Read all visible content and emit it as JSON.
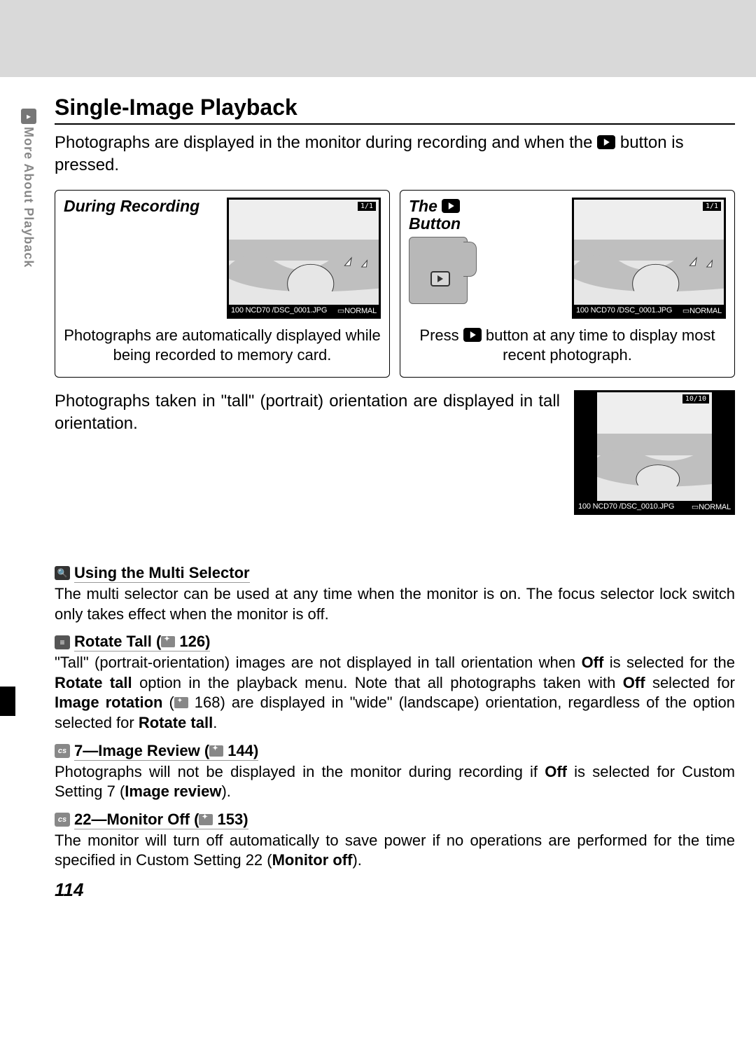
{
  "sidebar": {
    "label": "More About Playback"
  },
  "heading": "Single-Image Playback",
  "intro_a": "Photographs are displayed in the monitor during recording and when the ",
  "intro_b": " button is pressed.",
  "card1": {
    "label": "During Recording",
    "counter": "1/1",
    "file": "100  NCD70  /DSC_0001.JPG",
    "quality": "NORMAL",
    "text": "Photographs are automatically displayed while being recorded to memory card."
  },
  "card2": {
    "label_a": "The ",
    "label_b": " Button",
    "counter": "1/1",
    "file": "100  NCD70  /DSC_0001.JPG",
    "quality": "NORMAL",
    "text_a": "Press ",
    "text_b": " button at any time to display most recent photograph."
  },
  "portrait": {
    "text": "Photographs taken in \"tall\" (portrait) orientation are displayed in tall orientation.",
    "counter": "10/10",
    "file": "100 NCD70 /DSC_0010.JPG",
    "quality": "NORMAL"
  },
  "notes": {
    "n1": {
      "title": "Using the Multi Selector",
      "body": "The multi selector can be used at any time when the monitor is on.  The focus selector lock switch only takes effect when the monitor is off."
    },
    "n2": {
      "title_a": "Rotate Tall (",
      "title_page": " 126)",
      "body": "\"Tall\" (portrait-orientation) images are not displayed in tall orientation when Off is selected for the Rotate tall option in the playback menu.  Note that all photographs taken with Off selected for Image rotation ( 168) are displayed in \"wide\" (landscape) orientation, regardless of the option selected for Rotate tall."
    },
    "n3": {
      "title_a": "7—Image Review (",
      "title_page": " 144)",
      "body": "Photographs will not be displayed in the monitor during recording if Off is selected for Custom Setting 7 (Image review)."
    },
    "n4": {
      "title_a": "22—Monitor Off (",
      "title_page": " 153)",
      "body": "The monitor will turn off automatically to save power if no operations are performed for the time specified in Custom Setting 22 (Monitor off)."
    }
  },
  "pagenum": "114"
}
